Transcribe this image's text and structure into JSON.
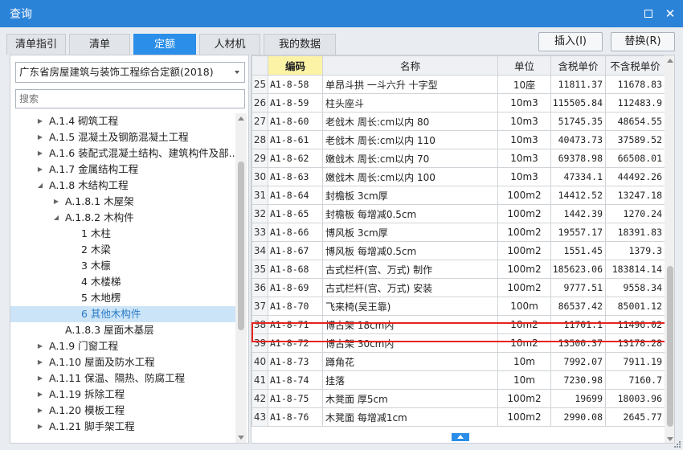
{
  "window": {
    "title": "查询"
  },
  "tabs": [
    {
      "label": "清单指引",
      "active": false
    },
    {
      "label": "清单",
      "active": false
    },
    {
      "label": "定额",
      "active": true
    },
    {
      "label": "人材机",
      "active": false
    },
    {
      "label": "我的数据",
      "active": false
    }
  ],
  "toolbar": {
    "insert_label": "插入(I)",
    "replace_label": "替换(R)"
  },
  "left": {
    "library_selected": "广东省房屋建筑与装饰工程综合定额(2018)",
    "search_placeholder": "搜索",
    "tree": [
      {
        "label": "A.1.4 砌筑工程",
        "level": 0,
        "expandable": true,
        "expanded": false,
        "selected": false
      },
      {
        "label": "A.1.5 混凝土及钢筋混凝土工程",
        "level": 0,
        "expandable": true,
        "expanded": false,
        "selected": false
      },
      {
        "label": "A.1.6 装配式混凝土结构、建筑构件及部...",
        "level": 0,
        "expandable": true,
        "expanded": false,
        "selected": false
      },
      {
        "label": "A.1.7 金属结构工程",
        "level": 0,
        "expandable": true,
        "expanded": false,
        "selected": false
      },
      {
        "label": "A.1.8 木结构工程",
        "level": 0,
        "expandable": true,
        "expanded": true,
        "selected": false
      },
      {
        "label": "A.1.8.1 木屋架",
        "level": 1,
        "expandable": true,
        "expanded": false,
        "selected": false
      },
      {
        "label": "A.1.8.2 木构件",
        "level": 1,
        "expandable": true,
        "expanded": true,
        "selected": false
      },
      {
        "label": "1 木柱",
        "level": 2,
        "expandable": false,
        "expanded": false,
        "selected": false
      },
      {
        "label": "2 木梁",
        "level": 2,
        "expandable": false,
        "expanded": false,
        "selected": false
      },
      {
        "label": "3 木檩",
        "level": 2,
        "expandable": false,
        "expanded": false,
        "selected": false
      },
      {
        "label": "4 木楼梯",
        "level": 2,
        "expandable": false,
        "expanded": false,
        "selected": false
      },
      {
        "label": "5 木地楞",
        "level": 2,
        "expandable": false,
        "expanded": false,
        "selected": false
      },
      {
        "label": "6 其他木构件",
        "level": 2,
        "expandable": false,
        "expanded": false,
        "selected": true
      },
      {
        "label": "A.1.8.3 屋面木基层",
        "level": 1,
        "expandable": false,
        "expanded": false,
        "selected": false
      },
      {
        "label": "A.1.9 门窗工程",
        "level": 0,
        "expandable": true,
        "expanded": false,
        "selected": false
      },
      {
        "label": "A.1.10 屋面及防水工程",
        "level": 0,
        "expandable": true,
        "expanded": false,
        "selected": false
      },
      {
        "label": "A.1.11 保温、隔热、防腐工程",
        "level": 0,
        "expandable": true,
        "expanded": false,
        "selected": false
      },
      {
        "label": "A.1.19 拆除工程",
        "level": 0,
        "expandable": true,
        "expanded": false,
        "selected": false
      },
      {
        "label": "A.1.20 模板工程",
        "level": 0,
        "expandable": true,
        "expanded": false,
        "selected": false
      },
      {
        "label": "A.1.21 脚手架工程",
        "level": 0,
        "expandable": true,
        "expanded": false,
        "selected": false
      }
    ]
  },
  "table": {
    "columns": [
      "",
      "编码",
      "名称",
      "单位",
      "含税单价",
      "不含税单价"
    ],
    "rows": [
      {
        "idx": "25",
        "code": "A1-8-58",
        "name": "单昂斗拱 一斗六升 十字型",
        "unit": "10座",
        "price_tax": "11811.37",
        "price_notax": "11678.83"
      },
      {
        "idx": "26",
        "code": "A1-8-59",
        "name": "柱头座斗",
        "unit": "10m3",
        "price_tax": "115505.84",
        "price_notax": "112483.9"
      },
      {
        "idx": "27",
        "code": "A1-8-60",
        "name": "老戗木 周长:cm以内 80",
        "unit": "10m3",
        "price_tax": "51745.35",
        "price_notax": "48654.55"
      },
      {
        "idx": "28",
        "code": "A1-8-61",
        "name": "老戗木 周长:cm以内 110",
        "unit": "10m3",
        "price_tax": "40473.73",
        "price_notax": "37589.52"
      },
      {
        "idx": "29",
        "code": "A1-8-62",
        "name": "嫩戗木 周长:cm以内 70",
        "unit": "10m3",
        "price_tax": "69378.98",
        "price_notax": "66508.01"
      },
      {
        "idx": "30",
        "code": "A1-8-63",
        "name": "嫩戗木 周长:cm以内 100",
        "unit": "10m3",
        "price_tax": "47334.1",
        "price_notax": "44492.26"
      },
      {
        "idx": "31",
        "code": "A1-8-64",
        "name": "封檐板 3cm厚",
        "unit": "100m2",
        "price_tax": "14412.52",
        "price_notax": "13247.18"
      },
      {
        "idx": "32",
        "code": "A1-8-65",
        "name": "封檐板 每增减0.5cm",
        "unit": "100m2",
        "price_tax": "1442.39",
        "price_notax": "1270.24"
      },
      {
        "idx": "33",
        "code": "A1-8-66",
        "name": "博风板 3cm厚",
        "unit": "100m2",
        "price_tax": "19557.17",
        "price_notax": "18391.83"
      },
      {
        "idx": "34",
        "code": "A1-8-67",
        "name": "博风板 每增减0.5cm",
        "unit": "100m2",
        "price_tax": "1551.45",
        "price_notax": "1379.3"
      },
      {
        "idx": "35",
        "code": "A1-8-68",
        "name": "古式栏杆(宫、万式) 制作",
        "unit": "100m2",
        "price_tax": "185623.06",
        "price_notax": "183814.14"
      },
      {
        "idx": "36",
        "code": "A1-8-69",
        "name": "古式栏杆(宫、万式) 安装",
        "unit": "100m2",
        "price_tax": "9777.51",
        "price_notax": "9558.34"
      },
      {
        "idx": "37",
        "code": "A1-8-70",
        "name": "飞来椅(吴王靠)",
        "unit": "100m",
        "price_tax": "86537.42",
        "price_notax": "85001.12"
      },
      {
        "idx": "38",
        "code": "A1-8-71",
        "name": "博古架 18cm内",
        "unit": "10m2",
        "price_tax": "11701.1",
        "price_notax": "11496.02"
      },
      {
        "idx": "39",
        "code": "A1-8-72",
        "name": "博古架 30cm内",
        "unit": "10m2",
        "price_tax": "13500.37",
        "price_notax": "13178.28"
      },
      {
        "idx": "40",
        "code": "A1-8-73",
        "name": "蹲角花",
        "unit": "10m",
        "price_tax": "7992.07",
        "price_notax": "7911.19"
      },
      {
        "idx": "41",
        "code": "A1-8-74",
        "name": "挂落",
        "unit": "10m",
        "price_tax": "7230.98",
        "price_notax": "7160.7"
      },
      {
        "idx": "42",
        "code": "A1-8-75",
        "name": "木凳面 厚5cm",
        "unit": "100m2",
        "price_tax": "19699",
        "price_notax": "18003.96"
      },
      {
        "idx": "43",
        "code": "A1-8-76",
        "name": "木凳面 每增减1cm",
        "unit": "100m2",
        "price_tax": "2990.08",
        "price_notax": "2645.77"
      }
    ]
  },
  "colors": {
    "titlebar": "#2b83d8",
    "active_tab": "#2b8ee8",
    "code_header": "#fdf3a6",
    "highlight": "#e8231c",
    "tree_selected": "#cce4f7"
  }
}
